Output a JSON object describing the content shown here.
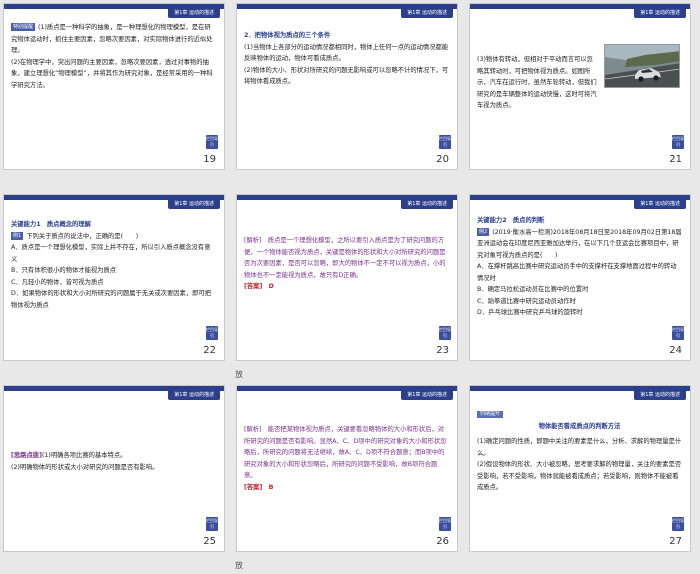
{
  "chapter_label": "第1章 运动的描述",
  "back_label": "栏目导引",
  "slides": [
    {
      "page": "19",
      "tag": "特别提醒",
      "paragraphs": [
        "(1)质点是一种科学的抽象，是一种理想化的物理模型，是在研究物体运动时，抓住主要因素，忽略次要因素，对实际物体进行的近似处理。",
        "(2)在物理学中，突出问题的主要因素，忽略次要因素，透过对事物的抽象，建立理想化“物理模型”，并将其作为研究对象，是经常采用的一种科学研究方法。"
      ]
    },
    {
      "page": "20",
      "title": "2．把物体视为质点的三个条件",
      "paragraphs": [
        "(1)当物体上各部分的运动情况都相同时，物体上任何一点的运动情况都能反映物体的运动，物体可看成质点。",
        "(2)物体的大小、形状对所研究的问题无影响或可以忽略不计的情况下，可将物体看成质点。"
      ]
    },
    {
      "page": "21",
      "paragraphs": [
        "(3)物体有转动，但相对于平动而言可以忽略其转动时，可把物体视为质点。如图所示，汽车在运行时，虽然车轮转动，但我们研究的是车辆整体的运动快慢，这时可将汽车视为质点。"
      ]
    },
    {
      "page": "22",
      "section": "关键能力1　质点概念的理解",
      "example_tag": "例1",
      "question": "下列关于质点的说法中，正确的是(　　)",
      "options": [
        "A．质点是一个理想化模型，实际上并不存在，所以引入质点概念没有意义",
        "B．只有体积很小的物体才能视为质点",
        "C．凡轻小的物体，皆可视为质点",
        "D．如果物体的形状和大小对所研究的问题属于无关或次要因素，即可把物体视为质点"
      ]
    },
    {
      "page": "23",
      "analysis": "[解析]　质点是一个理想化模型，之所以要引入质点是为了研究问题的方便，一个物体能否视为质点，关键是物体的形状和大小对所研究的问题是否为次要因素，是否可以忽略，即大的物体不一定不可以视为质点，小的物体也不一定能视为质点，故只有D正确。",
      "answer_label": "[答案]",
      "answer": "D"
    },
    {
      "page": "24",
      "section": "关键能力2　质点的判断",
      "example_tag": "例2",
      "question": "(2019·衡水高一检测)2018年08月18日至2018年09月02日第18届亚洲运动会在印度尼西亚雅加达举行，在以下几个亚运会比赛项目中，研究对象可视为质点的是(　　)",
      "options": [
        "A．在撑杆跳高比赛中研究运动员手中的支撑杆在支撑地面过程中的转动情况时",
        "B．确定马拉松运动员在比赛中的位置时",
        "C．跆拳道比赛中研究运动员动作时",
        "D．乒乓球比赛中研究乒乓球的旋转时"
      ]
    },
    {
      "page": "25",
      "hint_tag": "[思路点拨]",
      "paragraphs": [
        "(1)明确各项比赛的基本特点。",
        "(2)明确物体的形状或大小对研究的问题是否有影响。"
      ]
    },
    {
      "page": "26",
      "analysis": "[解析]　能否把某物体视为质点，关键要看忽略物体的大小和形状后，对所研究的问题是否有影响。显然A、C、D项中的研究对象的大小和形状忽略后，所研究的问题将无法继续，故A、C、D项不符合题意；而B项中的研究对象的大小和形状忽略后，所研究的问题不受影响，故B项符合题意。",
      "answer_label": "[答案]",
      "answer": "B"
    },
    {
      "page": "27",
      "box_tag": "归纳提升",
      "title": "物体能否看成质点的判断方法",
      "paragraphs": [
        "(1)确定问题的性质，即题中关注的要素是什么，分析、求解的物理量是什么。",
        "(2)假设物体的形状、大小被忽略，思考要求解的物理量，关注的要素是否受影响，若不受影响，物体就能被看成质点；若受影响，则物体不能被看成质点。"
      ]
    }
  ],
  "slide_marker": "放"
}
